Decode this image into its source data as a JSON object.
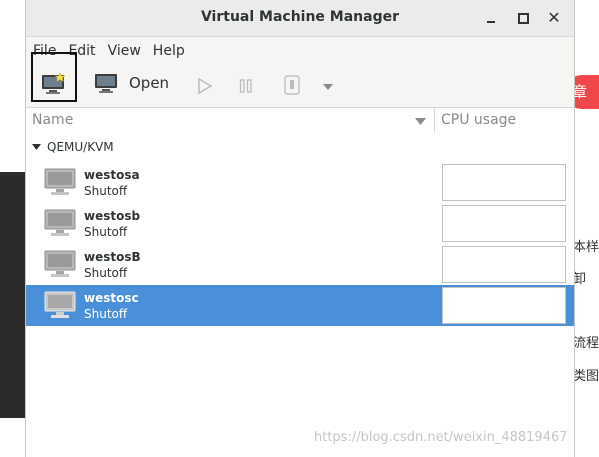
{
  "window": {
    "title": "Virtual Machine Manager"
  },
  "menubar": {
    "items": [
      "File",
      "Edit",
      "View",
      "Help"
    ]
  },
  "toolbar": {
    "open_label": "Open"
  },
  "columns": {
    "name": "Name",
    "cpu": "CPU usage"
  },
  "connection": {
    "name": "QEMU/KVM"
  },
  "vms": [
    {
      "name": "westosa",
      "state": "Shutoff",
      "selected": false
    },
    {
      "name": "westosb",
      "state": "Shutoff",
      "selected": false
    },
    {
      "name": "westosB",
      "state": "Shutoff",
      "selected": false
    },
    {
      "name": "westosc",
      "state": "Shutoff",
      "selected": true
    }
  ],
  "background": {
    "badge": "章",
    "fragments": [
      "本样",
      "卸",
      "流程",
      "类图"
    ],
    "watermark": "https://blog.csdn.net/weixin_48819467"
  },
  "colors": {
    "selection": "#4a90d9",
    "badge": "#f04848"
  }
}
